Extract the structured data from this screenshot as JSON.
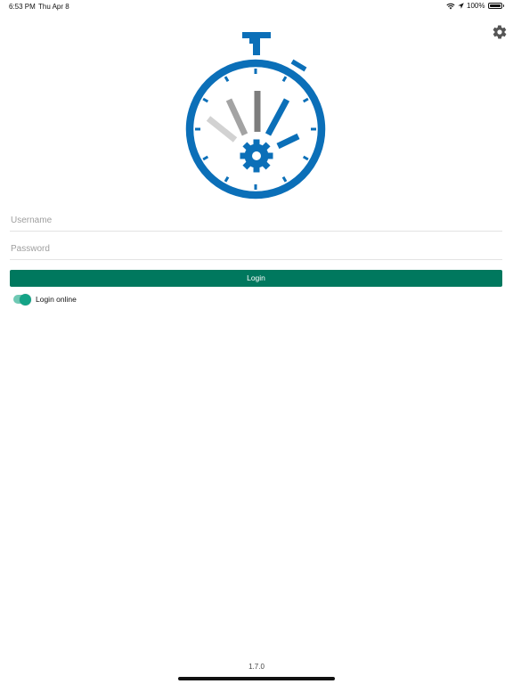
{
  "status_bar": {
    "time": "6:53 PM",
    "date": "Thu Apr 8",
    "battery_text": "100%",
    "icons": [
      "wifi-icon",
      "location-arrow-icon",
      "battery-icon"
    ]
  },
  "header": {
    "settings_icon": "gear-icon"
  },
  "logo": {
    "icon": "stopwatch-gear-icon",
    "colors": {
      "blue": "#0b6fb8",
      "gray_dark": "#7d7d7d",
      "gray_mid": "#a3a3a3",
      "gray_light": "#d2d2d2"
    }
  },
  "form": {
    "username_placeholder": "Username",
    "username_value": "",
    "password_placeholder": "Password",
    "password_value": "",
    "login_label": "Login",
    "login_online_label": "Login online",
    "login_online_enabled": true
  },
  "footer": {
    "version": "1.7.0"
  },
  "colors": {
    "accent": "#00785e",
    "toggle_track": "#6fc9b4",
    "toggle_knob": "#14a386",
    "background": "#ffffff"
  }
}
